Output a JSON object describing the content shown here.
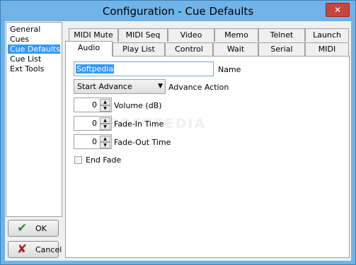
{
  "window": {
    "title": "Configuration - Cue Defaults",
    "close_label": "✕"
  },
  "sidebar": {
    "items": [
      {
        "label": "General"
      },
      {
        "label": "Cues"
      },
      {
        "label": "Cue Defaults",
        "selected": true
      },
      {
        "label": "Cue List"
      },
      {
        "label": "Ext Tools"
      }
    ]
  },
  "buttons": {
    "ok": {
      "label": "OK",
      "icon": "check-icon",
      "glyph": "✔",
      "color": "#2e8b2e"
    },
    "cancel": {
      "label": "Cancel",
      "icon": "x-icon",
      "glyph": "✘",
      "color": "#b22222"
    }
  },
  "tabs": {
    "row_back": [
      "MIDI Mute",
      "MIDI Seq",
      "Video",
      "Memo",
      "Telnet",
      "Launch"
    ],
    "row_front": [
      "Audio",
      "Play List",
      "Control",
      "Wait",
      "Serial",
      "MIDI"
    ],
    "active": "Audio"
  },
  "audio": {
    "name_value": "Softpedia",
    "name_label": "Name",
    "advance_value": "Start Advance",
    "advance_label": "Advance Action",
    "volume": {
      "value": "0",
      "label": "Volume (dB)"
    },
    "fade_in": {
      "value": "0",
      "label": "Fade-In Time"
    },
    "fade_out": {
      "value": "0",
      "label": "Fade-Out Time"
    },
    "end_fade": {
      "label": "End Fade",
      "checked": false
    }
  },
  "colors": {
    "titlebar": "#6fb3e8",
    "selection": "#3399ff"
  }
}
